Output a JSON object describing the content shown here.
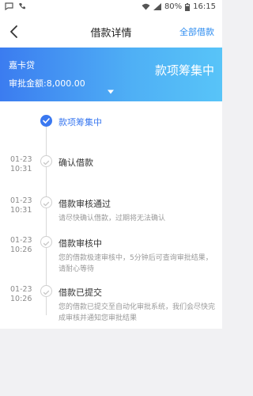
{
  "status_bar": {
    "battery": "80%",
    "time": "16:15"
  },
  "nav": {
    "title": "借款详情",
    "action": "全部借款"
  },
  "banner": {
    "product": "嘉卡贷",
    "amount": "审批金额:8,000.00",
    "status": "款项筹集中"
  },
  "steps": [
    {
      "date": "",
      "time": "",
      "title": "款项筹集中",
      "desc": "",
      "state": "done"
    },
    {
      "date": "01-23",
      "time": "10:31",
      "title": "确认借款",
      "desc": "",
      "state": "pending"
    },
    {
      "date": "01-23",
      "time": "10:31",
      "title": "借款审核通过",
      "desc": "请尽快确认借款，过期将无法确认",
      "state": "pending"
    },
    {
      "date": "01-23",
      "time": "10:26",
      "title": "借款审核中",
      "desc": "您的借款极速审核中，5分钟后可查询审批结果，请耐心等待",
      "state": "pending"
    },
    {
      "date": "01-23",
      "time": "10:26",
      "title": "借款已提交",
      "desc": "您的借款已提交至自动化审批系统，我们会尽快完成审核并通知您审批结果",
      "state": "pending"
    }
  ],
  "colors": {
    "accent": "#3a78f0",
    "banner_start": "#3b7cf0",
    "banner_end": "#58c4f8"
  }
}
